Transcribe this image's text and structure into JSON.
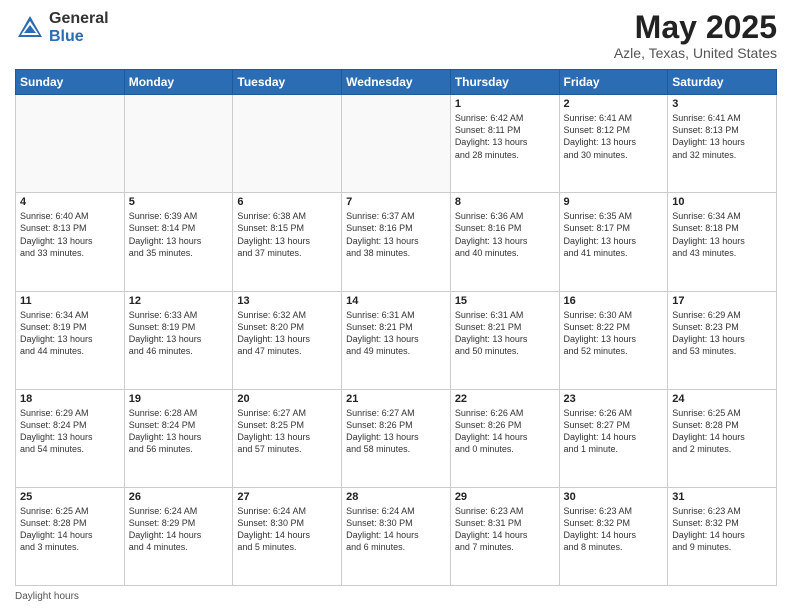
{
  "header": {
    "logo_general": "General",
    "logo_blue": "Blue",
    "title": "May 2025",
    "location": "Azle, Texas, United States"
  },
  "calendar": {
    "days_of_week": [
      "Sunday",
      "Monday",
      "Tuesday",
      "Wednesday",
      "Thursday",
      "Friday",
      "Saturday"
    ],
    "weeks": [
      [
        {
          "day": "",
          "info": ""
        },
        {
          "day": "",
          "info": ""
        },
        {
          "day": "",
          "info": ""
        },
        {
          "day": "",
          "info": ""
        },
        {
          "day": "1",
          "info": "Sunrise: 6:42 AM\nSunset: 8:11 PM\nDaylight: 13 hours\nand 28 minutes."
        },
        {
          "day": "2",
          "info": "Sunrise: 6:41 AM\nSunset: 8:12 PM\nDaylight: 13 hours\nand 30 minutes."
        },
        {
          "day": "3",
          "info": "Sunrise: 6:41 AM\nSunset: 8:13 PM\nDaylight: 13 hours\nand 32 minutes."
        }
      ],
      [
        {
          "day": "4",
          "info": "Sunrise: 6:40 AM\nSunset: 8:13 PM\nDaylight: 13 hours\nand 33 minutes."
        },
        {
          "day": "5",
          "info": "Sunrise: 6:39 AM\nSunset: 8:14 PM\nDaylight: 13 hours\nand 35 minutes."
        },
        {
          "day": "6",
          "info": "Sunrise: 6:38 AM\nSunset: 8:15 PM\nDaylight: 13 hours\nand 37 minutes."
        },
        {
          "day": "7",
          "info": "Sunrise: 6:37 AM\nSunset: 8:16 PM\nDaylight: 13 hours\nand 38 minutes."
        },
        {
          "day": "8",
          "info": "Sunrise: 6:36 AM\nSunset: 8:16 PM\nDaylight: 13 hours\nand 40 minutes."
        },
        {
          "day": "9",
          "info": "Sunrise: 6:35 AM\nSunset: 8:17 PM\nDaylight: 13 hours\nand 41 minutes."
        },
        {
          "day": "10",
          "info": "Sunrise: 6:34 AM\nSunset: 8:18 PM\nDaylight: 13 hours\nand 43 minutes."
        }
      ],
      [
        {
          "day": "11",
          "info": "Sunrise: 6:34 AM\nSunset: 8:19 PM\nDaylight: 13 hours\nand 44 minutes."
        },
        {
          "day": "12",
          "info": "Sunrise: 6:33 AM\nSunset: 8:19 PM\nDaylight: 13 hours\nand 46 minutes."
        },
        {
          "day": "13",
          "info": "Sunrise: 6:32 AM\nSunset: 8:20 PM\nDaylight: 13 hours\nand 47 minutes."
        },
        {
          "day": "14",
          "info": "Sunrise: 6:31 AM\nSunset: 8:21 PM\nDaylight: 13 hours\nand 49 minutes."
        },
        {
          "day": "15",
          "info": "Sunrise: 6:31 AM\nSunset: 8:21 PM\nDaylight: 13 hours\nand 50 minutes."
        },
        {
          "day": "16",
          "info": "Sunrise: 6:30 AM\nSunset: 8:22 PM\nDaylight: 13 hours\nand 52 minutes."
        },
        {
          "day": "17",
          "info": "Sunrise: 6:29 AM\nSunset: 8:23 PM\nDaylight: 13 hours\nand 53 minutes."
        }
      ],
      [
        {
          "day": "18",
          "info": "Sunrise: 6:29 AM\nSunset: 8:24 PM\nDaylight: 13 hours\nand 54 minutes."
        },
        {
          "day": "19",
          "info": "Sunrise: 6:28 AM\nSunset: 8:24 PM\nDaylight: 13 hours\nand 56 minutes."
        },
        {
          "day": "20",
          "info": "Sunrise: 6:27 AM\nSunset: 8:25 PM\nDaylight: 13 hours\nand 57 minutes."
        },
        {
          "day": "21",
          "info": "Sunrise: 6:27 AM\nSunset: 8:26 PM\nDaylight: 13 hours\nand 58 minutes."
        },
        {
          "day": "22",
          "info": "Sunrise: 6:26 AM\nSunset: 8:26 PM\nDaylight: 14 hours\nand 0 minutes."
        },
        {
          "day": "23",
          "info": "Sunrise: 6:26 AM\nSunset: 8:27 PM\nDaylight: 14 hours\nand 1 minute."
        },
        {
          "day": "24",
          "info": "Sunrise: 6:25 AM\nSunset: 8:28 PM\nDaylight: 14 hours\nand 2 minutes."
        }
      ],
      [
        {
          "day": "25",
          "info": "Sunrise: 6:25 AM\nSunset: 8:28 PM\nDaylight: 14 hours\nand 3 minutes."
        },
        {
          "day": "26",
          "info": "Sunrise: 6:24 AM\nSunset: 8:29 PM\nDaylight: 14 hours\nand 4 minutes."
        },
        {
          "day": "27",
          "info": "Sunrise: 6:24 AM\nSunset: 8:30 PM\nDaylight: 14 hours\nand 5 minutes."
        },
        {
          "day": "28",
          "info": "Sunrise: 6:24 AM\nSunset: 8:30 PM\nDaylight: 14 hours\nand 6 minutes."
        },
        {
          "day": "29",
          "info": "Sunrise: 6:23 AM\nSunset: 8:31 PM\nDaylight: 14 hours\nand 7 minutes."
        },
        {
          "day": "30",
          "info": "Sunrise: 6:23 AM\nSunset: 8:32 PM\nDaylight: 14 hours\nand 8 minutes."
        },
        {
          "day": "31",
          "info": "Sunrise: 6:23 AM\nSunset: 8:32 PM\nDaylight: 14 hours\nand 9 minutes."
        }
      ]
    ]
  },
  "footer": {
    "daylight_hours": "Daylight hours"
  }
}
